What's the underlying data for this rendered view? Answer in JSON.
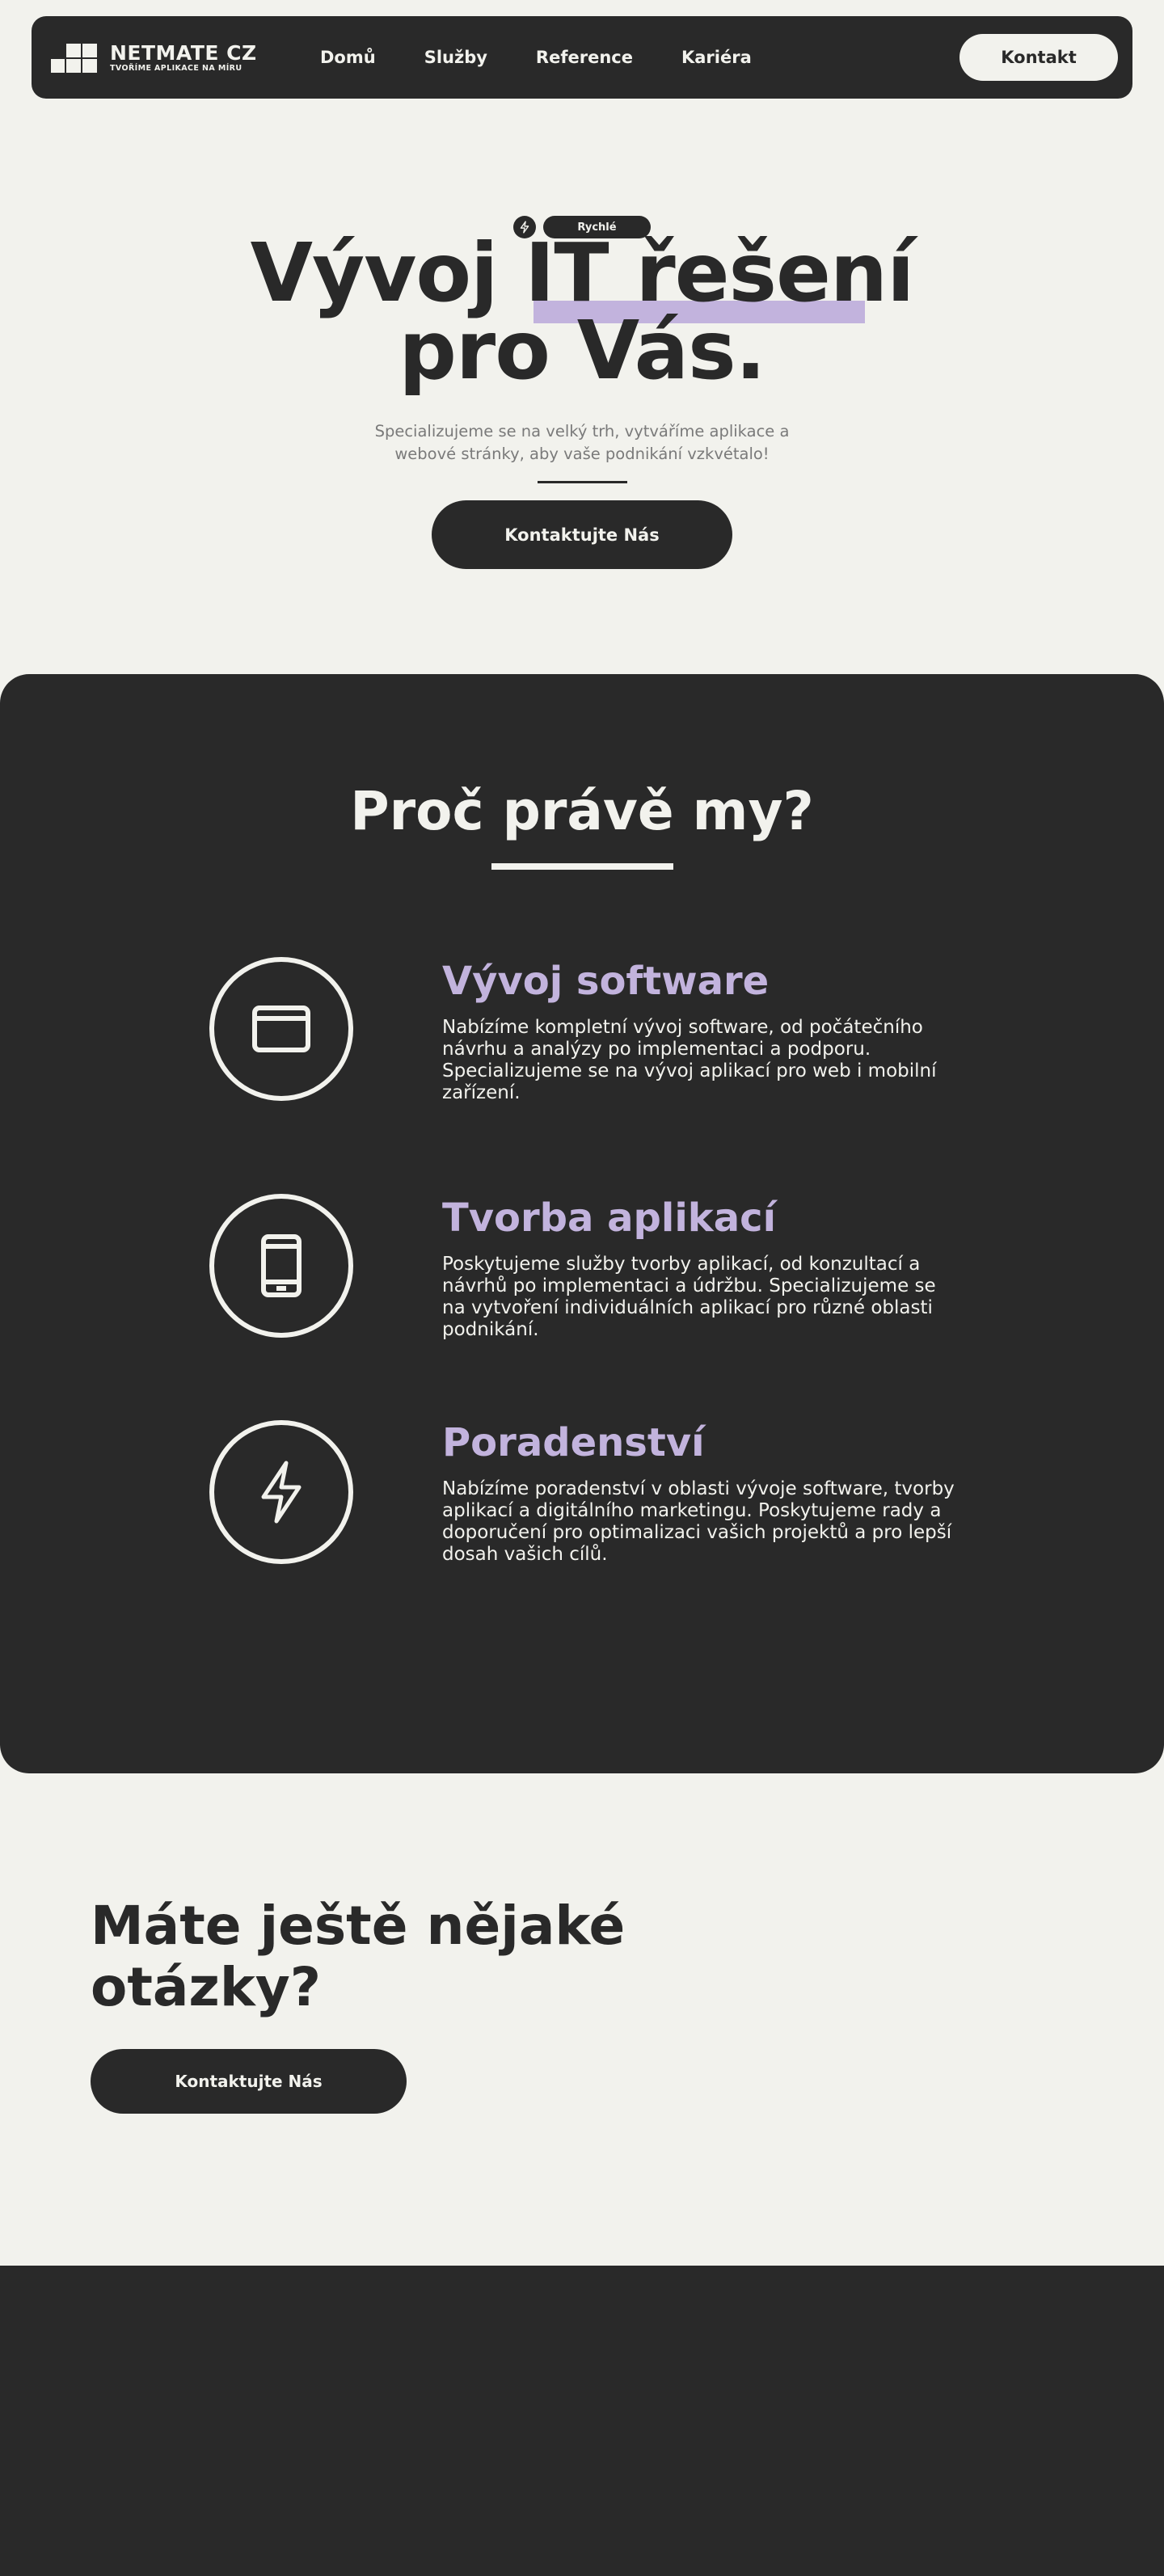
{
  "colors": {
    "background": "#f2f2ed",
    "dark": "#292929",
    "accent": "#c2b3dd",
    "muted": "#7a7a7a"
  },
  "nav": {
    "logo_name": "NETMATE CZ",
    "logo_tagline": "TVOŘÍME APLIKACE NA MÍRU",
    "links": [
      "Domů",
      "Služby",
      "Reference",
      "Kariéra"
    ],
    "cta": "Kontakt"
  },
  "hero": {
    "badge_icon": "lightning-icon",
    "badge_label": "Rychlé",
    "title_line1": "Vývoj IT řešení",
    "title_line2": "pro Vás.",
    "subtitle": "Specializujeme se na velký trh, vytváříme aplikace a webové stránky, aby vaše podnikání vzkvétalo!",
    "cta": "Kontaktujte Nás"
  },
  "why": {
    "title": "Proč právě my?",
    "features": [
      {
        "icon": "browser-window-icon",
        "title": "Vývoj software",
        "description": "Nabízíme kompletní vývoj software, od počátečního návrhu a analýzy po implementaci a podporu. Specializujeme se na vývoj aplikací pro web i mobilní zařízení."
      },
      {
        "icon": "mobile-phone-icon",
        "title": "Tvorba aplikací",
        "description": "Poskytujeme služby tvorby aplikací, od konzultací a návrhů po implementaci a údržbu. Specializujeme se na vytvoření individuálních aplikací pro různé oblasti podnikání."
      },
      {
        "icon": "lightning-icon",
        "title": "Poradenství",
        "description": "Nabízíme poradenství v oblasti vývoje software, tvorby aplikací a digitálního marketingu. Poskytujeme rady a doporučení pro optimalizaci vašich projektů a pro lepší dosah vašich cílů."
      }
    ]
  },
  "questions": {
    "title": "Máte ještě nějaké otázky?",
    "cta": "Kontaktujte Nás"
  }
}
